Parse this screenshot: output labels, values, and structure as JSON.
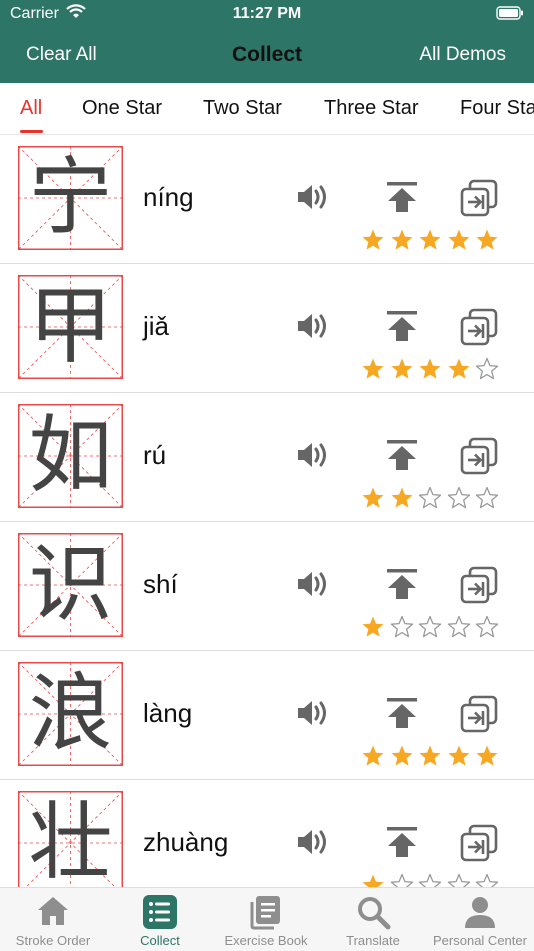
{
  "status": {
    "carrier": "Carrier",
    "time": "11:27 PM"
  },
  "nav": {
    "left": "Clear All",
    "title": "Collect",
    "right": "All Demos"
  },
  "tabs": [
    "All",
    "One Star",
    "Two Star",
    "Three Star",
    "Four Star"
  ],
  "active_tab": 0,
  "items": [
    {
      "char": "宁",
      "pinyin": "níng",
      "stars": 5
    },
    {
      "char": "甲",
      "pinyin": "jiǎ",
      "stars": 4
    },
    {
      "char": "如",
      "pinyin": "rú",
      "stars": 2
    },
    {
      "char": "识",
      "pinyin": "shí",
      "stars": 1
    },
    {
      "char": "浪",
      "pinyin": "làng",
      "stars": 5
    },
    {
      "char": "壮",
      "pinyin": "zhuàng",
      "stars": 1
    }
  ],
  "max_stars": 5,
  "tabbar": [
    {
      "label": "Stroke Order",
      "icon": "house-icon"
    },
    {
      "label": "Collect",
      "icon": "list-icon"
    },
    {
      "label": "Exercise Book",
      "icon": "book-icon"
    },
    {
      "label": "Translate",
      "icon": "magnifier-icon"
    },
    {
      "label": "Personal Center",
      "icon": "person-icon"
    }
  ],
  "active_tabbar": 1,
  "colors": {
    "brand_green": "#2d7566",
    "active_red": "#e8322c",
    "star_gold": "#f7a823",
    "grid_red": "#e84a4a",
    "icon_gray": "#666666"
  }
}
